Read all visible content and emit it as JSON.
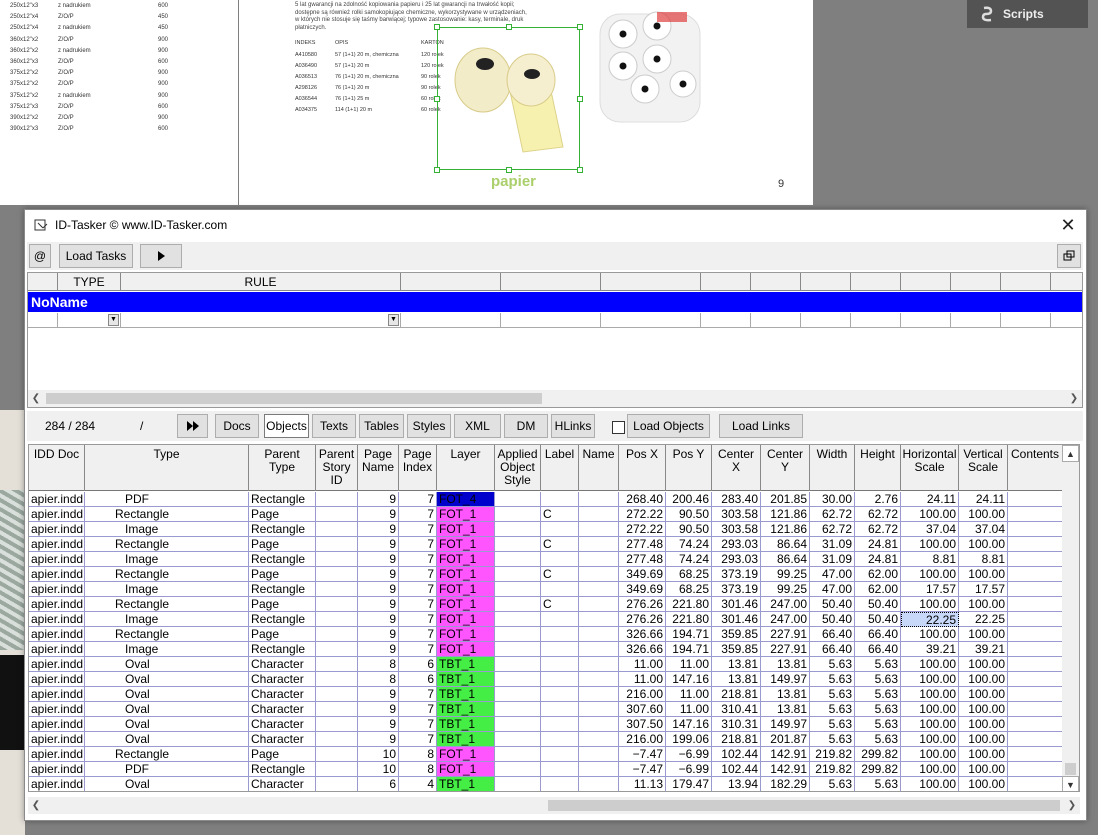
{
  "background": {
    "left_page_rows": [
      [
        "250x12\"x3",
        "z nadrukiem",
        "600"
      ],
      [
        "250x12\"x4",
        "Z/O/P",
        "450"
      ],
      [
        "250x12\"x4",
        "z nadrukiem",
        "450"
      ],
      [
        "360x12\"x2",
        "Z/O/P",
        "900"
      ],
      [
        "360x12\"x2",
        "z nadrukiem",
        "900"
      ],
      [
        "360x12\"x3",
        "Z/O/P",
        "600"
      ],
      [
        "375x12\"x2",
        "Z/O/P",
        "900"
      ],
      [
        "375x12\"x2",
        "Z/O/P",
        "900"
      ],
      [
        "375x12\"x2",
        "z nadrukiem",
        "900"
      ],
      [
        "375x12\"x3",
        "Z/O/P",
        "600"
      ],
      [
        "390x12\"x2",
        "Z/O/P",
        "900"
      ],
      [
        "390x12\"x3",
        "Z/O/P",
        "600"
      ]
    ],
    "paragraph": "5 lat gwarancji na zdolność kopiowania papieru i 25 lat gwarancji na trwałość kopii; dostępne są również rolki samokopiujące chemiczne, wykorzystywane w urządzeniach, w których nie stosuje się taśmy barwiącej; typowe zastosowanie: kasy, terminale, druk płatniczych.",
    "product_table": {
      "headers": [
        "INDEKS",
        "OPIS",
        "KARTON"
      ],
      "rows": [
        [
          "A410580",
          "57 (1+1) 20 m, chemiczna",
          "120 rolek"
        ],
        [
          "A036490",
          "57 (1+1) 20 m",
          "120 rolek"
        ],
        [
          "A036513",
          "76 (1+1) 20 m, chemiczna",
          "90 rolek"
        ],
        [
          "A298126",
          "76 (1+1) 20 m",
          "90 rolek"
        ],
        [
          "A036544",
          "76 (1+1) 25 m",
          "60 rolek"
        ],
        [
          "A034375",
          "114 (1+1) 20 m",
          "60 rolek"
        ]
      ]
    },
    "logo": "papier",
    "page_number": "9"
  },
  "scripts_panel": {
    "label": "Scripts"
  },
  "dialog": {
    "title": "ID-Tasker  © www.ID-Tasker.com",
    "toolbar": {
      "at_label": "@",
      "load_tasks_label": "Load Tasks"
    },
    "rules_grid": {
      "headers": [
        "TYPE",
        "RULE"
      ],
      "group_name": "NoName"
    },
    "toolbar2": {
      "counter": "284 / 284",
      "slash": "/",
      "buttons": [
        "Docs",
        "Objects",
        "Texts",
        "Tables",
        "Styles",
        "XML",
        "DM",
        "HLinks"
      ],
      "active_button": "Objects",
      "load_objects_label": "Load Objects",
      "load_links_label": "Load Links"
    },
    "objects_grid": {
      "headers": [
        "IDD Doc",
        "Type",
        "Parent\nType",
        "Parent\nStory\nID",
        "Page\nName",
        "Page\nIndex",
        "Layer",
        "Applied\nObject\nStyle",
        "Label",
        "Name",
        "Pos X",
        "Pos Y",
        "Center\nX",
        "Center\nY",
        "Width",
        "Height",
        "Horizontal\nScale",
        "Vertical\nScale",
        "Contents"
      ],
      "rows": [
        [
          "apier.indd",
          "PDF",
          "Rectangle",
          "",
          "9",
          "7",
          "FOT_4",
          "",
          "",
          "",
          "268.40",
          "200.46",
          "283.40",
          "201.85",
          "30.00",
          "2.76",
          "24.11",
          "24.11",
          ""
        ],
        [
          "apier.indd",
          "Rectangle",
          "Page",
          "",
          "9",
          "7",
          "FOT_1",
          "",
          "C",
          "",
          "272.22",
          "90.50",
          "303.58",
          "121.86",
          "62.72",
          "62.72",
          "100.00",
          "100.00",
          ""
        ],
        [
          "apier.indd",
          "Image",
          "Rectangle",
          "",
          "9",
          "7",
          "FOT_1",
          "",
          "",
          "",
          "272.22",
          "90.50",
          "303.58",
          "121.86",
          "62.72",
          "62.72",
          "37.04",
          "37.04",
          ""
        ],
        [
          "apier.indd",
          "Rectangle",
          "Page",
          "",
          "9",
          "7",
          "FOT_1",
          "",
          "C",
          "",
          "277.48",
          "74.24",
          "293.03",
          "86.64",
          "31.09",
          "24.81",
          "100.00",
          "100.00",
          ""
        ],
        [
          "apier.indd",
          "Image",
          "Rectangle",
          "",
          "9",
          "7",
          "FOT_1",
          "",
          "",
          "",
          "277.48",
          "74.24",
          "293.03",
          "86.64",
          "31.09",
          "24.81",
          "8.81",
          "8.81",
          ""
        ],
        [
          "apier.indd",
          "Rectangle",
          "Page",
          "",
          "9",
          "7",
          "FOT_1",
          "",
          "C",
          "",
          "349.69",
          "68.25",
          "373.19",
          "99.25",
          "47.00",
          "62.00",
          "100.00",
          "100.00",
          ""
        ],
        [
          "apier.indd",
          "Image",
          "Rectangle",
          "",
          "9",
          "7",
          "FOT_1",
          "",
          "",
          "",
          "349.69",
          "68.25",
          "373.19",
          "99.25",
          "47.00",
          "62.00",
          "17.57",
          "17.57",
          ""
        ],
        [
          "apier.indd",
          "Rectangle",
          "Page",
          "",
          "9",
          "7",
          "FOT_1",
          "",
          "C",
          "",
          "276.26",
          "221.80",
          "301.46",
          "247.00",
          "50.40",
          "50.40",
          "100.00",
          "100.00",
          ""
        ],
        [
          "apier.indd",
          "Image",
          "Rectangle",
          "",
          "9",
          "7",
          "FOT_1",
          "",
          "",
          "",
          "276.26",
          "221.80",
          "301.46",
          "247.00",
          "50.40",
          "50.40",
          "22.25",
          "22.25",
          ""
        ],
        [
          "apier.indd",
          "Rectangle",
          "Page",
          "",
          "9",
          "7",
          "FOT_1",
          "",
          "",
          "",
          "326.66",
          "194.71",
          "359.85",
          "227.91",
          "66.40",
          "66.40",
          "100.00",
          "100.00",
          ""
        ],
        [
          "apier.indd",
          "Image",
          "Rectangle",
          "",
          "9",
          "7",
          "FOT_1",
          "",
          "",
          "",
          "326.66",
          "194.71",
          "359.85",
          "227.91",
          "66.40",
          "66.40",
          "39.21",
          "39.21",
          ""
        ],
        [
          "apier.indd",
          "Oval",
          "Character",
          "",
          "8",
          "6",
          "TBT_1",
          "",
          "",
          "",
          "11.00",
          "11.00",
          "13.81",
          "13.81",
          "5.63",
          "5.63",
          "100.00",
          "100.00",
          ""
        ],
        [
          "apier.indd",
          "Oval",
          "Character",
          "",
          "8",
          "6",
          "TBT_1",
          "",
          "",
          "",
          "11.00",
          "147.16",
          "13.81",
          "149.97",
          "5.63",
          "5.63",
          "100.00",
          "100.00",
          ""
        ],
        [
          "apier.indd",
          "Oval",
          "Character",
          "",
          "9",
          "7",
          "TBT_1",
          "",
          "",
          "",
          "216.00",
          "11.00",
          "218.81",
          "13.81",
          "5.63",
          "5.63",
          "100.00",
          "100.00",
          ""
        ],
        [
          "apier.indd",
          "Oval",
          "Character",
          "",
          "9",
          "7",
          "TBT_1",
          "",
          "",
          "",
          "307.60",
          "11.00",
          "310.41",
          "13.81",
          "5.63",
          "5.63",
          "100.00",
          "100.00",
          ""
        ],
        [
          "apier.indd",
          "Oval",
          "Character",
          "",
          "9",
          "7",
          "TBT_1",
          "",
          "",
          "",
          "307.50",
          "147.16",
          "310.31",
          "149.97",
          "5.63",
          "5.63",
          "100.00",
          "100.00",
          ""
        ],
        [
          "apier.indd",
          "Oval",
          "Character",
          "",
          "9",
          "7",
          "TBT_1",
          "",
          "",
          "",
          "216.00",
          "199.06",
          "218.81",
          "201.87",
          "5.63",
          "5.63",
          "100.00",
          "100.00",
          ""
        ],
        [
          "apier.indd",
          "Rectangle",
          "Page",
          "",
          "10",
          "8",
          "FOT_1",
          "",
          "",
          "",
          "−7.47",
          "−6.99",
          "102.44",
          "142.91",
          "219.82",
          "299.82",
          "100.00",
          "100.00",
          ""
        ],
        [
          "apier.indd",
          "PDF",
          "Rectangle",
          "",
          "10",
          "8",
          "FOT_1",
          "",
          "",
          "",
          "−7.47",
          "−6.99",
          "102.44",
          "142.91",
          "219.82",
          "299.82",
          "100.00",
          "100.00",
          ""
        ],
        [
          "apier.indd",
          "Oval",
          "Character",
          "",
          "6",
          "4",
          "TBT_1",
          "",
          "",
          "",
          "11.13",
          "179.47",
          "13.94",
          "182.29",
          "5.63",
          "5.63",
          "100.00",
          "100.00",
          ""
        ]
      ],
      "selected_cell": {
        "row": 8,
        "col": 16
      }
    }
  },
  "colors": {
    "group_row": "#0000ff",
    "layer_fot_4": "#0000cc",
    "layer_fot_1": "#ff55ff",
    "layer_tbt_1": "#44ee44",
    "selected_cell": "#c8d8f8",
    "gridline": "#9a9ad0"
  }
}
